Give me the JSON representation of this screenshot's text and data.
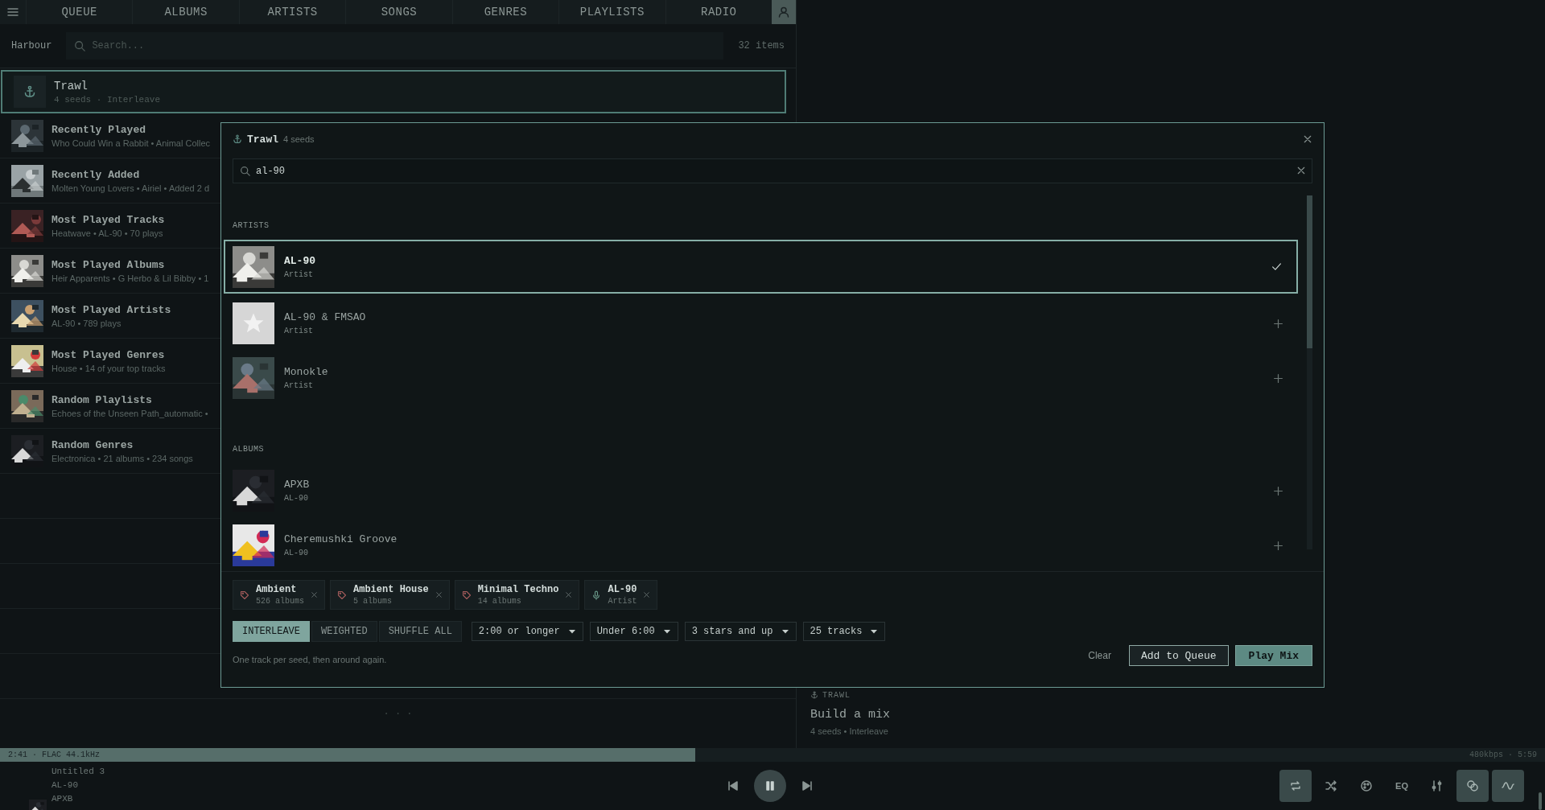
{
  "nav": {
    "tabs": [
      {
        "label": "QUEUE",
        "selected": false
      },
      {
        "label": "ALBUMS",
        "selected": false
      },
      {
        "label": "ARTISTS",
        "selected": false
      },
      {
        "label": "SONGS",
        "selected": false
      },
      {
        "label": "GENRES",
        "selected": false
      },
      {
        "label": "PLAYLISTS",
        "selected": false
      },
      {
        "label": "RADIO",
        "selected": false
      }
    ]
  },
  "library": {
    "source": "Harbour",
    "search": {
      "placeholder": "Search..."
    },
    "count": "32 items",
    "items": [
      {
        "kind": "mix",
        "title": "Trawl",
        "subtitle": "4 seeds · Interleave",
        "selected": true
      },
      {
        "kind": "picture",
        "title": "Recently Played",
        "subtitle": "Who Could Win a Rabbit • Animal Collec",
        "selected": false
      },
      {
        "kind": "picture",
        "title": "Recently Added",
        "subtitle": "Molten Young Lovers • Airiel • Added 2 d",
        "selected": false
      },
      {
        "kind": "picture",
        "title": "Most Played Tracks",
        "subtitle": "Heatwave • AL-90 • 70 plays",
        "selected": false
      },
      {
        "kind": "picture",
        "title": "Most Played Albums",
        "subtitle": "Heir Apparents • G Herbo & Lil Bibby • 1",
        "selected": false
      },
      {
        "kind": "picture",
        "title": "Most Played Artists",
        "subtitle": "AL-90 • 789 plays",
        "selected": false
      },
      {
        "kind": "picture",
        "title": "Most Played Genres",
        "subtitle": "House • 14 of your top tracks",
        "selected": false
      },
      {
        "kind": "picture",
        "title": "Random Playlists",
        "subtitle": "Echoes of the Unseen Path_automatic •",
        "selected": false
      },
      {
        "kind": "picture",
        "title": "Random Genres",
        "subtitle": "Electronica • 21 albums • 234 songs",
        "selected": false
      }
    ],
    "loading": "· · ·"
  },
  "mix_card": {
    "label": "TRAWL",
    "title": "Build a mix",
    "subtitle": "4 seeds • Interleave"
  },
  "dialog": {
    "title": "Trawl",
    "count": "4 seeds",
    "search": {
      "value": "al-90"
    },
    "sections": [
      {
        "heading": "ARTISTS",
        "results": [
          {
            "kind": "picture",
            "title": "AL-90",
            "subtitle": "Artist",
            "selected": true
          },
          {
            "kind": "placeholder",
            "title": "AL-90 & FMSAO",
            "subtitle": "Artist",
            "selected": false
          },
          {
            "kind": "picture",
            "title": "Monokle",
            "subtitle": "Artist",
            "selected": false
          }
        ]
      },
      {
        "heading": "ALBUMS",
        "results": [
          {
            "kind": "picture",
            "title": "APXB",
            "subtitle": "AL-90",
            "selected": false
          },
          {
            "kind": "picture",
            "title": "Cheremushki Groove",
            "subtitle": "AL-90",
            "selected": false
          }
        ]
      }
    ],
    "seeds": [
      {
        "kind": "genre",
        "name": "Ambient",
        "detail": "526 albums"
      },
      {
        "kind": "genre",
        "name": "Ambient House",
        "detail": "5 albums"
      },
      {
        "kind": "genre",
        "name": "Minimal Techno",
        "detail": "14 albums"
      },
      {
        "kind": "artist",
        "name": "AL-90",
        "detail": "Artist"
      }
    ],
    "modes": [
      {
        "label": "INTERLEAVE",
        "selected": true
      },
      {
        "label": "WEIGHTED",
        "selected": false
      },
      {
        "label": "SHUFFLE ALL",
        "selected": false
      }
    ],
    "filters": [
      "2:00 or longer",
      "Under 6:00",
      "3 stars and up",
      "25 tracks"
    ],
    "hint": "One track per seed, then around again.",
    "actions": [
      {
        "kind": "link",
        "label": "Clear"
      },
      {
        "kind": "secondary",
        "label": "Add to Queue"
      },
      {
        "kind": "primary",
        "label": "Play Mix"
      }
    ]
  },
  "player": {
    "elapsed_info": "2:41 · FLAC 44.1kHz",
    "level": 0.45,
    "stream_info": "480kbps · 5:59",
    "track": {
      "title": "Untitled 3",
      "artist": "AL-90",
      "album": "APXB"
    },
    "playing": true,
    "toggles": [
      {
        "kind": "repeat",
        "on": true
      },
      {
        "kind": "shuffle",
        "on": false
      },
      {
        "kind": "palette",
        "on": false
      },
      {
        "kind": "eq",
        "label": "EQ",
        "on": false
      },
      {
        "kind": "sliders",
        "on": false
      },
      {
        "kind": "link",
        "on": true
      },
      {
        "kind": "wave",
        "on": true
      }
    ]
  }
}
